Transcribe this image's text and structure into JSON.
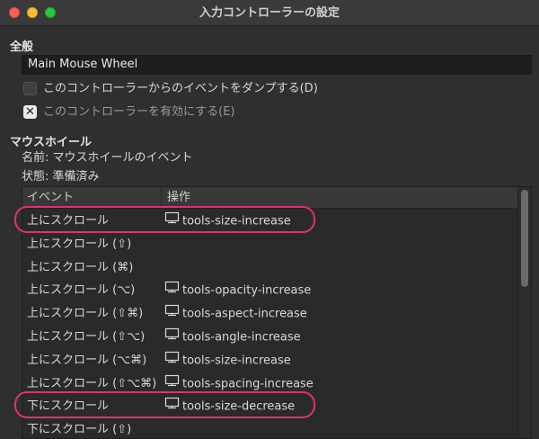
{
  "window": {
    "title": "入力コントローラーの設定"
  },
  "general": {
    "section_title": "全般",
    "name_value": "Main Mouse Wheel",
    "dump_events_label": "このコントローラーからのイベントをダンプする(D)",
    "enable_label": "このコントローラーを有効にする(E)"
  },
  "wheel": {
    "section_title": "マウスホイール",
    "name_line": "名前: マウスホイールのイベント",
    "state_line": "状態: 準備済み"
  },
  "table": {
    "col_event": "イベント",
    "col_action": "操作",
    "rows": [
      {
        "event": "上にスクロール",
        "action": "tools-size-increase",
        "icon": "tool-icon",
        "highlighted": true
      },
      {
        "event": "上にスクロール (⇧)",
        "action": "",
        "icon": ""
      },
      {
        "event": "上にスクロール (⌘)",
        "action": "",
        "icon": ""
      },
      {
        "event": "上にスクロール (⌥)",
        "action": "tools-opacity-increase",
        "icon": "tool-icon"
      },
      {
        "event": "上にスクロール (⇧⌘)",
        "action": "tools-aspect-increase",
        "icon": "tool-icon"
      },
      {
        "event": "上にスクロール (⇧⌥)",
        "action": "tools-angle-increase",
        "icon": "tool-icon"
      },
      {
        "event": "上にスクロール (⌥⌘)",
        "action": "tools-size-increase",
        "icon": "tool-icon"
      },
      {
        "event": "上にスクロール (⇧⌥⌘)",
        "action": "tools-spacing-increase",
        "icon": "tool-icon"
      },
      {
        "event": "下にスクロール",
        "action": "tools-size-decrease",
        "icon": "tool-icon",
        "highlighted": true
      },
      {
        "event": "下にスクロール (⇧)",
        "action": "",
        "icon": ""
      }
    ]
  },
  "colors": {
    "highlight": "#e0307a"
  }
}
